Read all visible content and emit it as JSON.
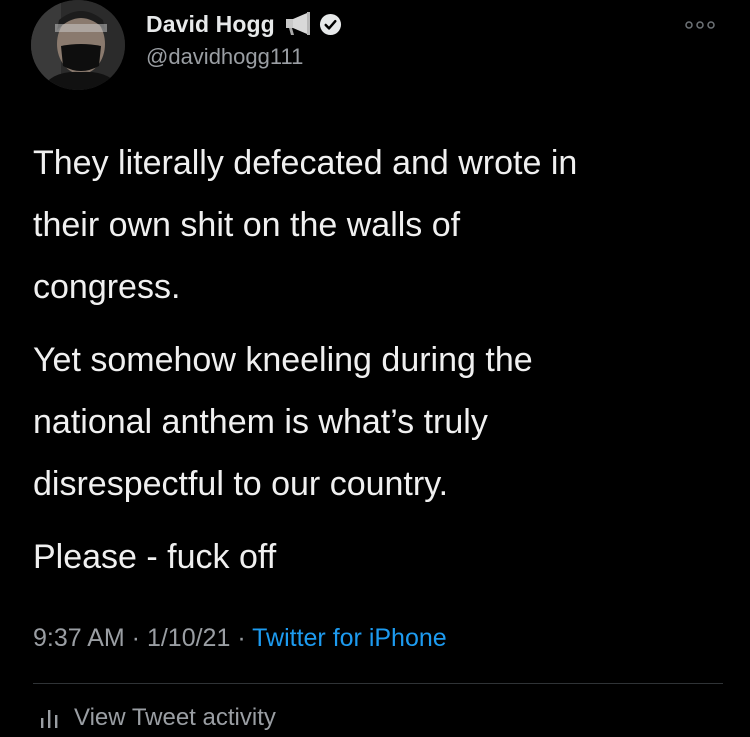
{
  "author": {
    "display_name": "David Hogg",
    "handle": "@davidhogg111",
    "badges": [
      "megaphone-icon",
      "verified-icon"
    ]
  },
  "header": {
    "more_icon": "more-icon"
  },
  "tweet": {
    "paragraphs": [
      "They literally defecated and wrote in\ntheir own shit on the walls of\ncongress.",
      "Yet somehow kneeling during the\nnational anthem is what’s truly\ndisrespectful to our country.",
      "Please - fuck off"
    ]
  },
  "meta": {
    "time": "9:37 AM",
    "separator1": " · ",
    "date": "1/10/21",
    "separator2": " · ",
    "source": "Twitter for iPhone"
  },
  "activity": {
    "label": "View Tweet activity",
    "icon": "bar-chart-icon"
  },
  "colors": {
    "background": "#000000",
    "text": "#f0f0f0",
    "secondary": "#9a9ea3",
    "link": "#1d9bf0",
    "divider": "#2f3336"
  }
}
